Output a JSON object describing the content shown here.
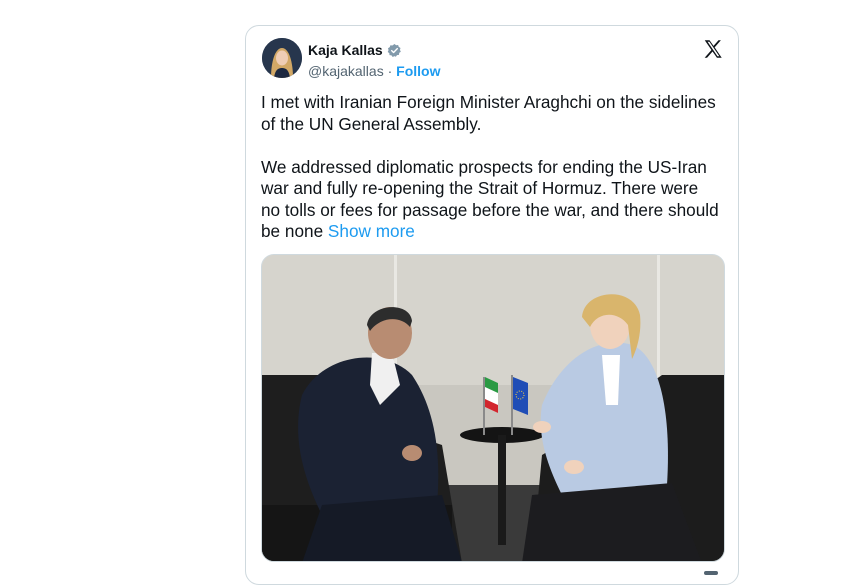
{
  "tweet": {
    "author_name": "Kaja Kallas",
    "handle": "@kajakallas",
    "separator": " · ",
    "follow_label": "Follow",
    "text": "I met with Iranian Foreign Minister Araghchi on the sidelines of the UN General Assembly.\n\nWe addressed diplomatic prospects for ending the US-Iran war and fully re-opening the Strait of Hormuz. There were no tolls or fees for passage before the war, and there should be none",
    "show_more_label": "Show more"
  },
  "icons": {
    "verified": "verified-badge-icon",
    "platform": "x-logo-icon"
  },
  "colors": {
    "link": "#1d9bf0",
    "text": "#0f1419",
    "muted": "#536471",
    "border": "#cfd9de"
  }
}
